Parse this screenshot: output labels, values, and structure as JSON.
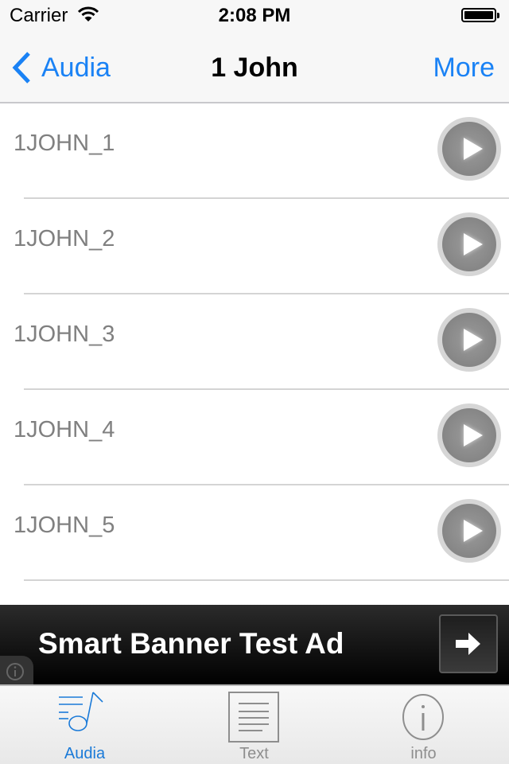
{
  "status_bar": {
    "carrier": "Carrier",
    "time": "2:08 PM",
    "battery_level": 1.0
  },
  "nav": {
    "back_label": "Audia",
    "title": "1 John",
    "right_label": "More"
  },
  "tracks": [
    {
      "label": "1JOHN_1"
    },
    {
      "label": "1JOHN_2"
    },
    {
      "label": "1JOHN_3"
    },
    {
      "label": "1JOHN_4"
    },
    {
      "label": "1JOHN_5"
    }
  ],
  "ad": {
    "text": "Smart Banner Test Ad"
  },
  "tabs": [
    {
      "label": "Audia",
      "icon": "music-list-icon",
      "active": true
    },
    {
      "label": "Text",
      "icon": "document-icon",
      "active": false
    },
    {
      "label": "info",
      "icon": "info-icon",
      "active": false
    }
  ],
  "colors": {
    "accent": "#1a82f5",
    "track_text": "#808080",
    "separator": "#d4d4d4"
  }
}
